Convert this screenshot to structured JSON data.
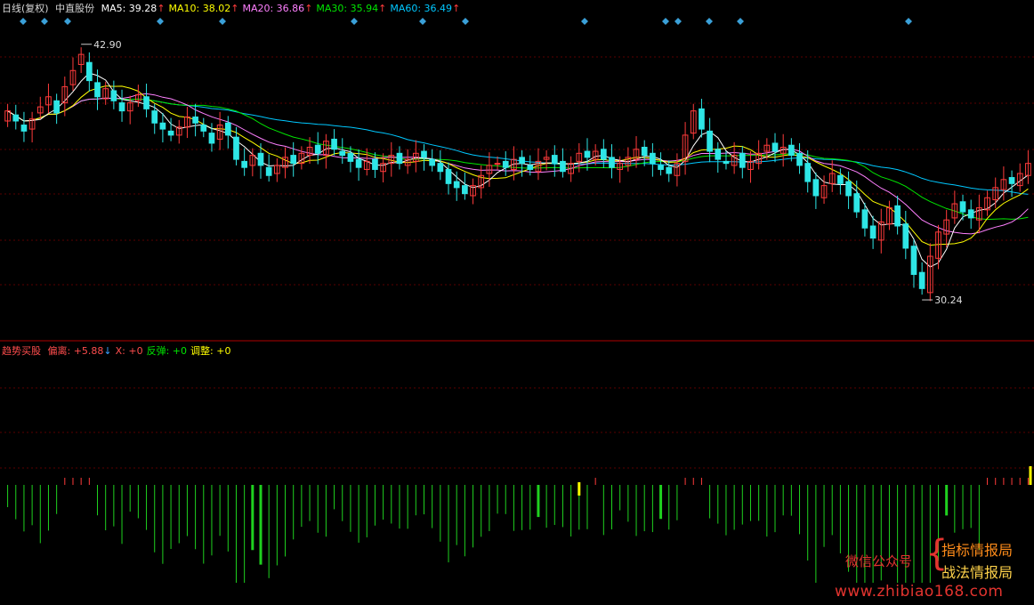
{
  "header": {
    "period": "日线(复权)",
    "stock": "中直股份",
    "ma": [
      {
        "label": "MA5: 39.28",
        "arrow": "↑",
        "color": "#ffffff"
      },
      {
        "label": "MA10: 38.02",
        "arrow": "↑",
        "color": "#ffff00"
      },
      {
        "label": "MA20: 36.86",
        "arrow": "↑",
        "color": "#ff80ff"
      },
      {
        "label": "MA30: 35.94",
        "arrow": "↑",
        "color": "#00e600"
      },
      {
        "label": "MA60: 36.49",
        "arrow": "↑",
        "color": "#00c8ff"
      }
    ]
  },
  "indicator": {
    "name": "趋势买股",
    "items": [
      {
        "label": "偏离: +5.88",
        "arrow": "↓",
        "color": "#ff4d4d"
      },
      {
        "label": "X: +0",
        "arrow": "",
        "color": "#ff4d4d"
      },
      {
        "label": "反弹: +0",
        "arrow": "",
        "color": "#00e600"
      },
      {
        "label": "调整: +0",
        "arrow": "",
        "color": "#ffff00"
      }
    ]
  },
  "annotations": {
    "high": "42.90",
    "low": "30.24"
  },
  "watermark": {
    "wechat": "微信公众号",
    "brace": "{",
    "line1": "指标情报局",
    "line2": "战法情报局",
    "url": "www.zhibiao168.com"
  },
  "colors": {
    "up": "#ff3b3b",
    "down": "#2ee6e6",
    "ma5": "#ffffff",
    "ma10": "#ffff00",
    "ma20": "#ff80ff",
    "ma30": "#00e600",
    "ma60": "#00c8ff",
    "bar": "#1fd11f",
    "barYellow": "#ffff00",
    "barRed": "#ff3b3b",
    "signal": "#3aa0d8"
  },
  "chart_data": {
    "type": "candlestick",
    "price_range": [
      28.7,
      44.3
    ],
    "high": 42.9,
    "low": 30.24,
    "closes": [
      39.6,
      39.1,
      38.6,
      39.2,
      39.8,
      40.3,
      39.5,
      40.8,
      41.6,
      42.4,
      41.1,
      40.3,
      40.7,
      40.1,
      39.6,
      40.0,
      40.4,
      39.7,
      39.0,
      38.7,
      38.4,
      38.8,
      39.3,
      39.0,
      38.6,
      38.0,
      38.9,
      38.4,
      37.2,
      36.8,
      37.4,
      36.9,
      36.4,
      36.9,
      37.3,
      37.0,
      37.5,
      37.8,
      37.5,
      38.1,
      37.7,
      37.4,
      37.1,
      36.8,
      37.1,
      36.7,
      37.0,
      37.4,
      37.0,
      37.2,
      37.5,
      37.3,
      36.9,
      36.6,
      36.0,
      35.8,
      35.5,
      35.9,
      36.4,
      36.9,
      37.0,
      36.8,
      37.2,
      37.0,
      36.7,
      37.1,
      37.3,
      37.0,
      36.6,
      37.0,
      37.5,
      37.3,
      37.6,
      37.2,
      36.8,
      37.0,
      37.3,
      37.7,
      37.4,
      37.0,
      36.7,
      36.5,
      37.0,
      38.4,
      39.6,
      38.7,
      37.6,
      37.2,
      37.0,
      37.4,
      36.8,
      37.1,
      37.5,
      37.9,
      37.6,
      37.8,
      37.4,
      36.9,
      36.1,
      35.4,
      35.9,
      36.5,
      36.0,
      35.4,
      34.6,
      33.8,
      33.3,
      34.1,
      34.8,
      33.9,
      32.8,
      31.5,
      30.8,
      32.4,
      33.6,
      34.2,
      35.0,
      34.6,
      34.3,
      34.8,
      35.3,
      35.8,
      36.2,
      36.0,
      36.5,
      37.0
    ],
    "opens": [
      39.1,
      39.4,
      38.9,
      38.7,
      39.5,
      39.9,
      40.1,
      40.0,
      40.9,
      41.9,
      42.0,
      41.0,
      40.2,
      40.6,
      40.0,
      39.6,
      40.1,
      40.3,
      39.6,
      39.0,
      38.6,
      38.4,
      38.8,
      39.3,
      38.9,
      38.5,
      38.2,
      39.0,
      38.3,
      37.1,
      36.9,
      37.5,
      36.8,
      36.5,
      36.8,
      37.4,
      37.0,
      37.4,
      37.9,
      37.4,
      38.2,
      37.6,
      37.5,
      37.2,
      36.7,
      37.2,
      36.6,
      37.0,
      37.5,
      36.9,
      37.1,
      37.6,
      37.2,
      37.0,
      36.7,
      36.1,
      35.9,
      35.4,
      35.8,
      36.5,
      37.0,
      37.1,
      36.7,
      37.3,
      36.9,
      36.6,
      37.2,
      37.4,
      37.1,
      36.5,
      37.1,
      37.6,
      37.2,
      37.7,
      37.3,
      36.7,
      36.9,
      37.2,
      37.8,
      37.5,
      36.9,
      36.8,
      36.4,
      37.1,
      38.5,
      39.7,
      38.6,
      37.7,
      37.1,
      36.9,
      37.5,
      36.7,
      37.0,
      37.6,
      38.0,
      37.5,
      37.9,
      37.5,
      37.0,
      36.2,
      35.3,
      36.0,
      36.4,
      36.1,
      35.5,
      34.7,
      33.9,
      33.2,
      34.0,
      34.9,
      34.0,
      32.9,
      31.6,
      30.6,
      32.3,
      33.5,
      34.3,
      35.1,
      34.7,
      34.2,
      34.7,
      35.2,
      35.7,
      36.3,
      35.9,
      36.4
    ],
    "moving_averages": {
      "MA5": 39.28,
      "MA10": 38.02,
      "MA20": 36.86,
      "MA30": 35.94,
      "MA60": 36.49
    }
  }
}
